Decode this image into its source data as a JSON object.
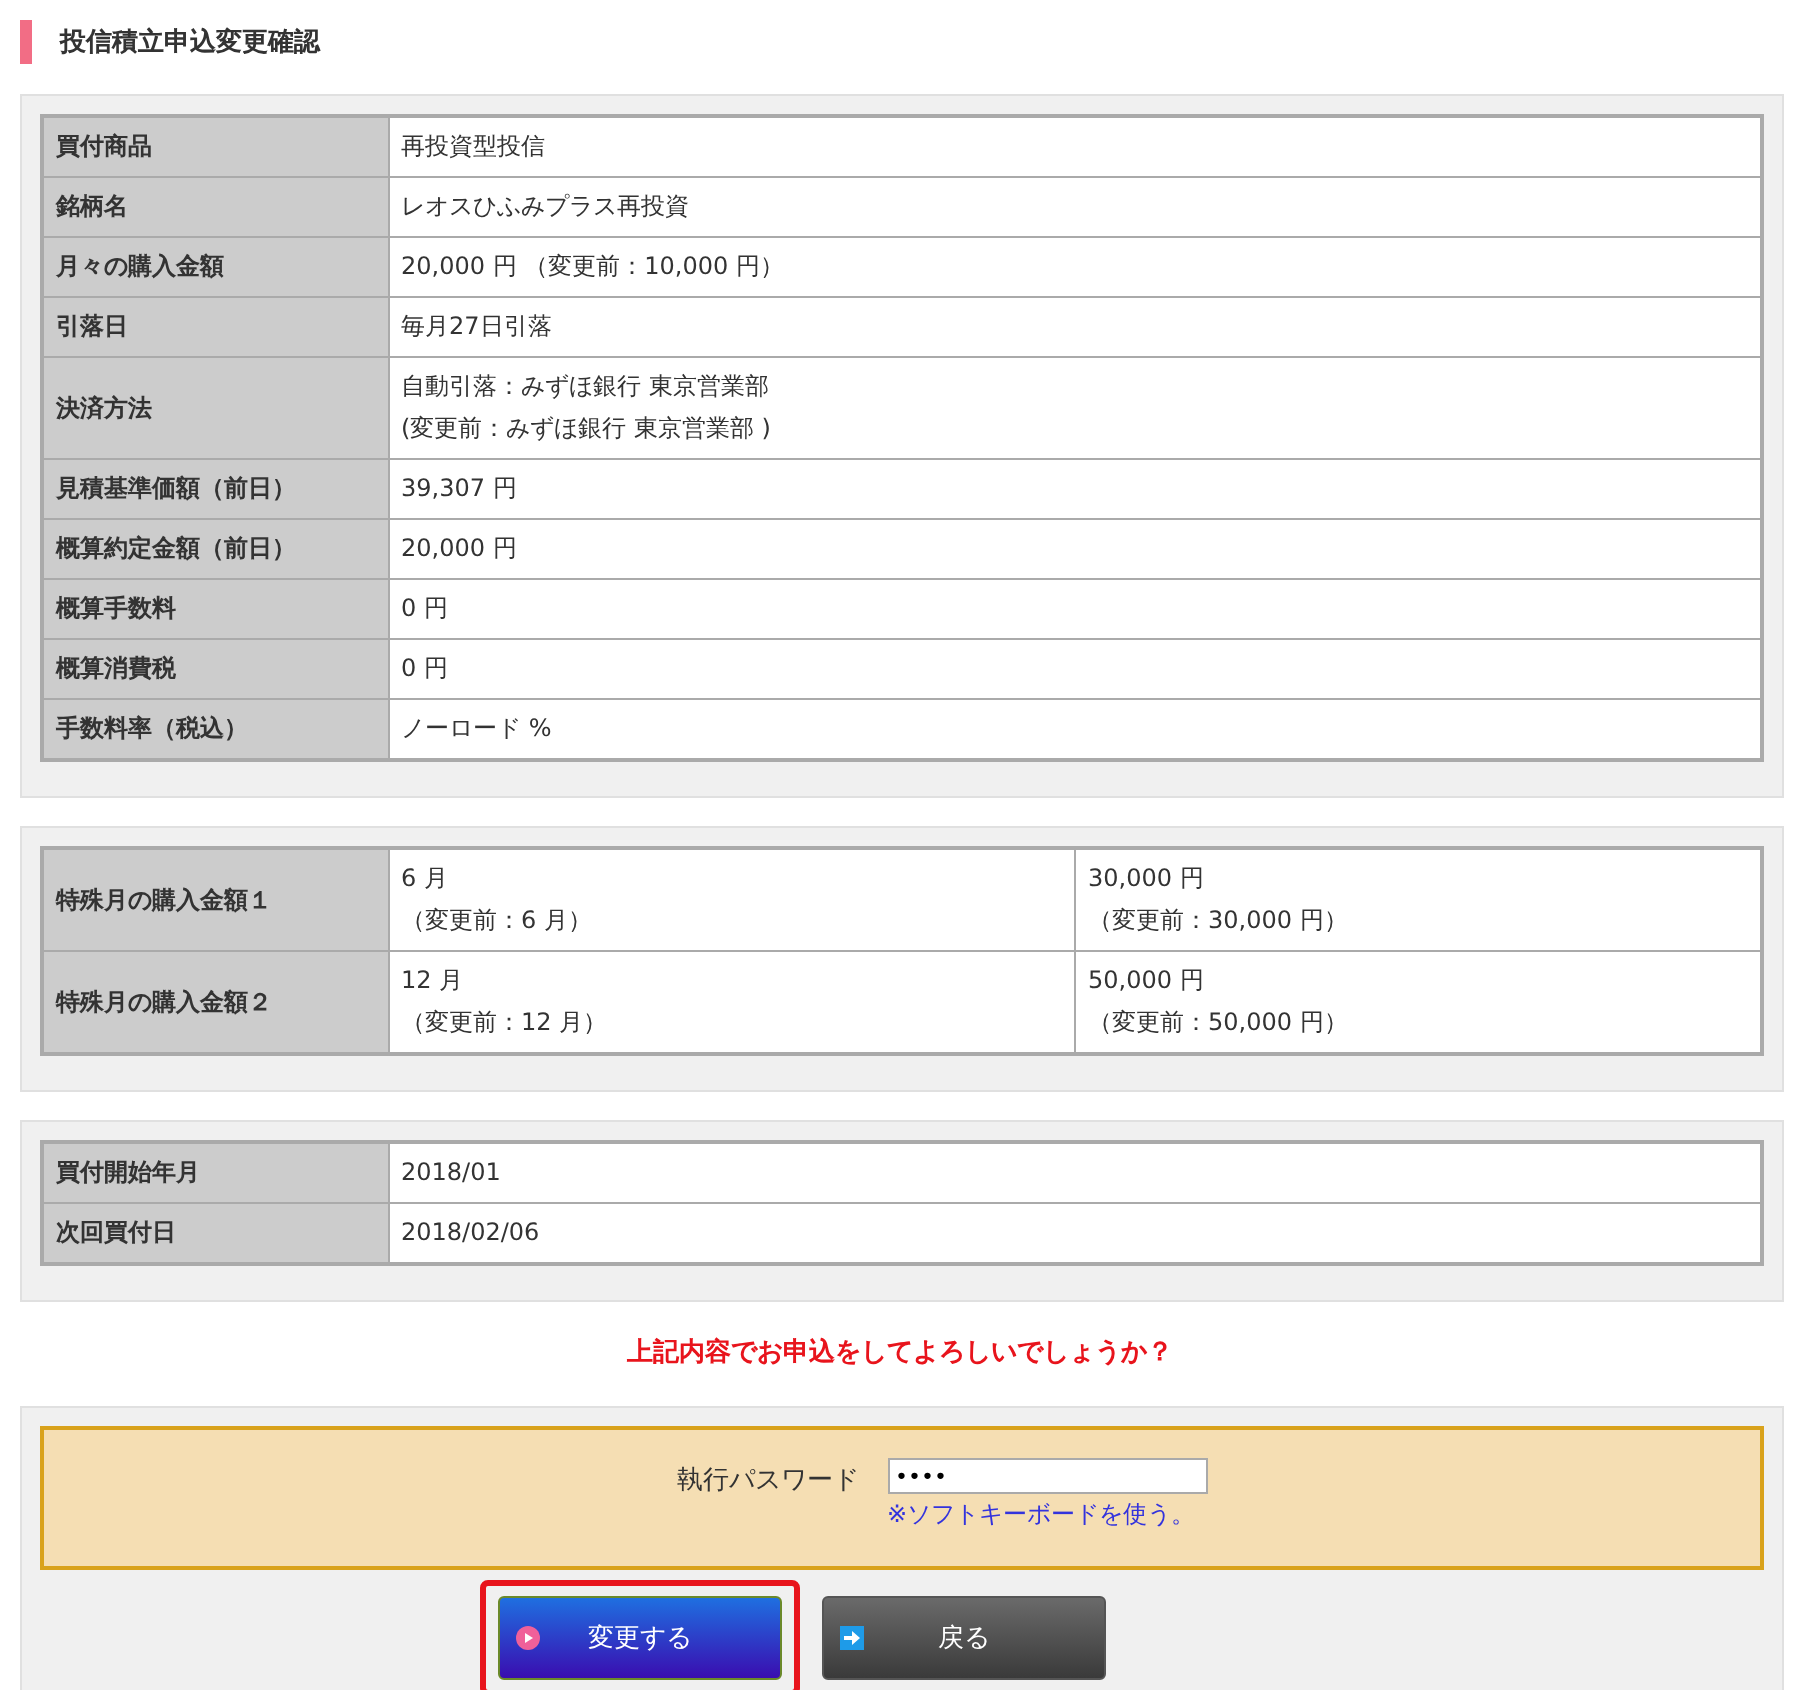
{
  "title": "投信積立申込変更確認",
  "tables": [
    {
      "rows": [
        {
          "label": "買付商品",
          "cells": [
            [
              "再投資型投信"
            ]
          ]
        },
        {
          "label": "銘柄名",
          "cells": [
            [
              "レオスひふみプラス再投資"
            ]
          ]
        },
        {
          "label": "月々の購入金額",
          "cells": [
            [
              "20,000 円 （変更前：10,000 円）"
            ]
          ]
        },
        {
          "label": "引落日",
          "cells": [
            [
              "毎月27日引落"
            ]
          ]
        },
        {
          "label": "決済方法",
          "cells": [
            [
              "自動引落：みずほ銀行 東京営業部",
              "(変更前：みずほ銀行 東京営業部 )"
            ]
          ]
        },
        {
          "label": "見積基準価額（前日）",
          "cells": [
            [
              "39,307 円"
            ]
          ]
        },
        {
          "label": "概算約定金額（前日）",
          "cells": [
            [
              "20,000 円"
            ]
          ]
        },
        {
          "label": "概算手数料",
          "cells": [
            [
              "0 円"
            ]
          ]
        },
        {
          "label": "概算消費税",
          "cells": [
            [
              "0 円"
            ]
          ]
        },
        {
          "label": "手数料率（税込）",
          "cells": [
            [
              "ノーロード %"
            ]
          ]
        }
      ]
    },
    {
      "rows": [
        {
          "label": "特殊月の購入金額１",
          "cells": [
            [
              "6 月",
              "（変更前：6 月）"
            ],
            [
              "30,000 円",
              "（変更前：30,000 円）"
            ]
          ]
        },
        {
          "label": "特殊月の購入金額２",
          "cells": [
            [
              "12 月",
              "（変更前：12 月）"
            ],
            [
              "50,000 円",
              "（変更前：50,000 円）"
            ]
          ]
        }
      ]
    },
    {
      "rows": [
        {
          "label": "買付開始年月",
          "cells": [
            [
              "2018/01"
            ]
          ]
        },
        {
          "label": "次回買付日",
          "cells": [
            [
              "2018/02/06"
            ]
          ]
        }
      ]
    }
  ],
  "confirm_message": "上記内容でお申込をしてよろしいでしょうか？",
  "password": {
    "label": "執行パスワード",
    "value": "••••",
    "link": "※ソフトキーボードを使う。"
  },
  "buttons": [
    {
      "label": "変更する",
      "kind": "primary",
      "highlighted": true
    },
    {
      "label": "戻る",
      "kind": "back",
      "highlighted": false
    }
  ]
}
